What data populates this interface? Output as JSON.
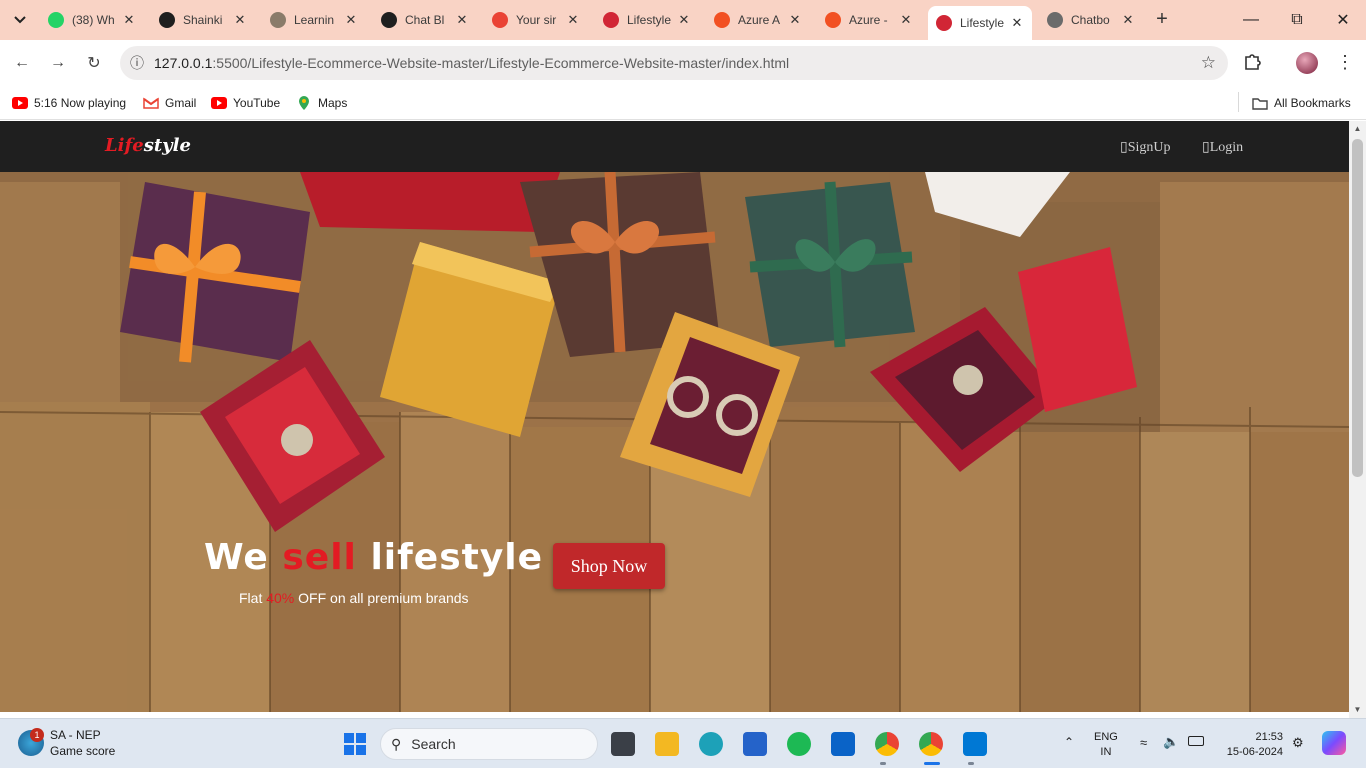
{
  "browser": {
    "tabs": [
      {
        "title": "(38) Wh",
        "icon": "whatsapp-icon",
        "color": "#25d366"
      },
      {
        "title": "Shainki",
        "icon": "github-icon",
        "color": "#1f1f1f"
      },
      {
        "title": "Learnin",
        "icon": "learning-icon",
        "color": "#8a7b6a"
      },
      {
        "title": "Chat Bl",
        "icon": "chatgpt-icon",
        "color": "#1f1f1f"
      },
      {
        "title": "Your sir",
        "icon": "gmail-icon",
        "color": "#ea4335"
      },
      {
        "title": "Lifestyle",
        "icon": "lifestyle-icon",
        "color": "#d12635"
      },
      {
        "title": "Azure A",
        "icon": "microsoft-icon",
        "color": "#f25022"
      },
      {
        "title": "Azure -",
        "icon": "microsoft-icon",
        "color": "#f25022"
      },
      {
        "title": "Lifestyle",
        "icon": "lifestyle-icon",
        "color": "#d12635",
        "active": true
      },
      {
        "title": "Chatbo",
        "icon": "globe-icon",
        "color": "#6b6b6b"
      }
    ],
    "url_host": "127.0.0.1",
    "url_rest": ":5500/Lifestyle-Ecommerce-Website-master/Lifestyle-Ecommerce-Website-master/index.html",
    "bookmarks": [
      {
        "label": "5:16 Now playing",
        "icon": "youtube-icon"
      },
      {
        "label": "Gmail",
        "icon": "gmail-icon"
      },
      {
        "label": "YouTube",
        "icon": "youtube-icon"
      },
      {
        "label": "Maps",
        "icon": "maps-icon"
      }
    ],
    "all_bookmarks": "All Bookmarks"
  },
  "site": {
    "logo_red": "Life",
    "logo_white": "style",
    "nav": {
      "signup": "▯SignUp",
      "login": "▯Login"
    },
    "hero": {
      "title_we": "We ",
      "title_sell": "sell",
      "title_rest": " lifestyle",
      "sub_pre": "Flat ",
      "sub_pct": "40%",
      "sub_post": " OFF on all premium brands",
      "button": "Shop Now"
    },
    "colors": {
      "accent": "#e31b23",
      "button": "#c0282a",
      "nav_bg": "#1f1f1f"
    }
  },
  "taskbar": {
    "weather_badge": "1",
    "weather_line1": "SA - NEP",
    "weather_line2": "Game score",
    "search_label": "Search",
    "lang1": "ENG",
    "lang2": "IN",
    "time": "21:53",
    "date": "15-06-2024"
  }
}
